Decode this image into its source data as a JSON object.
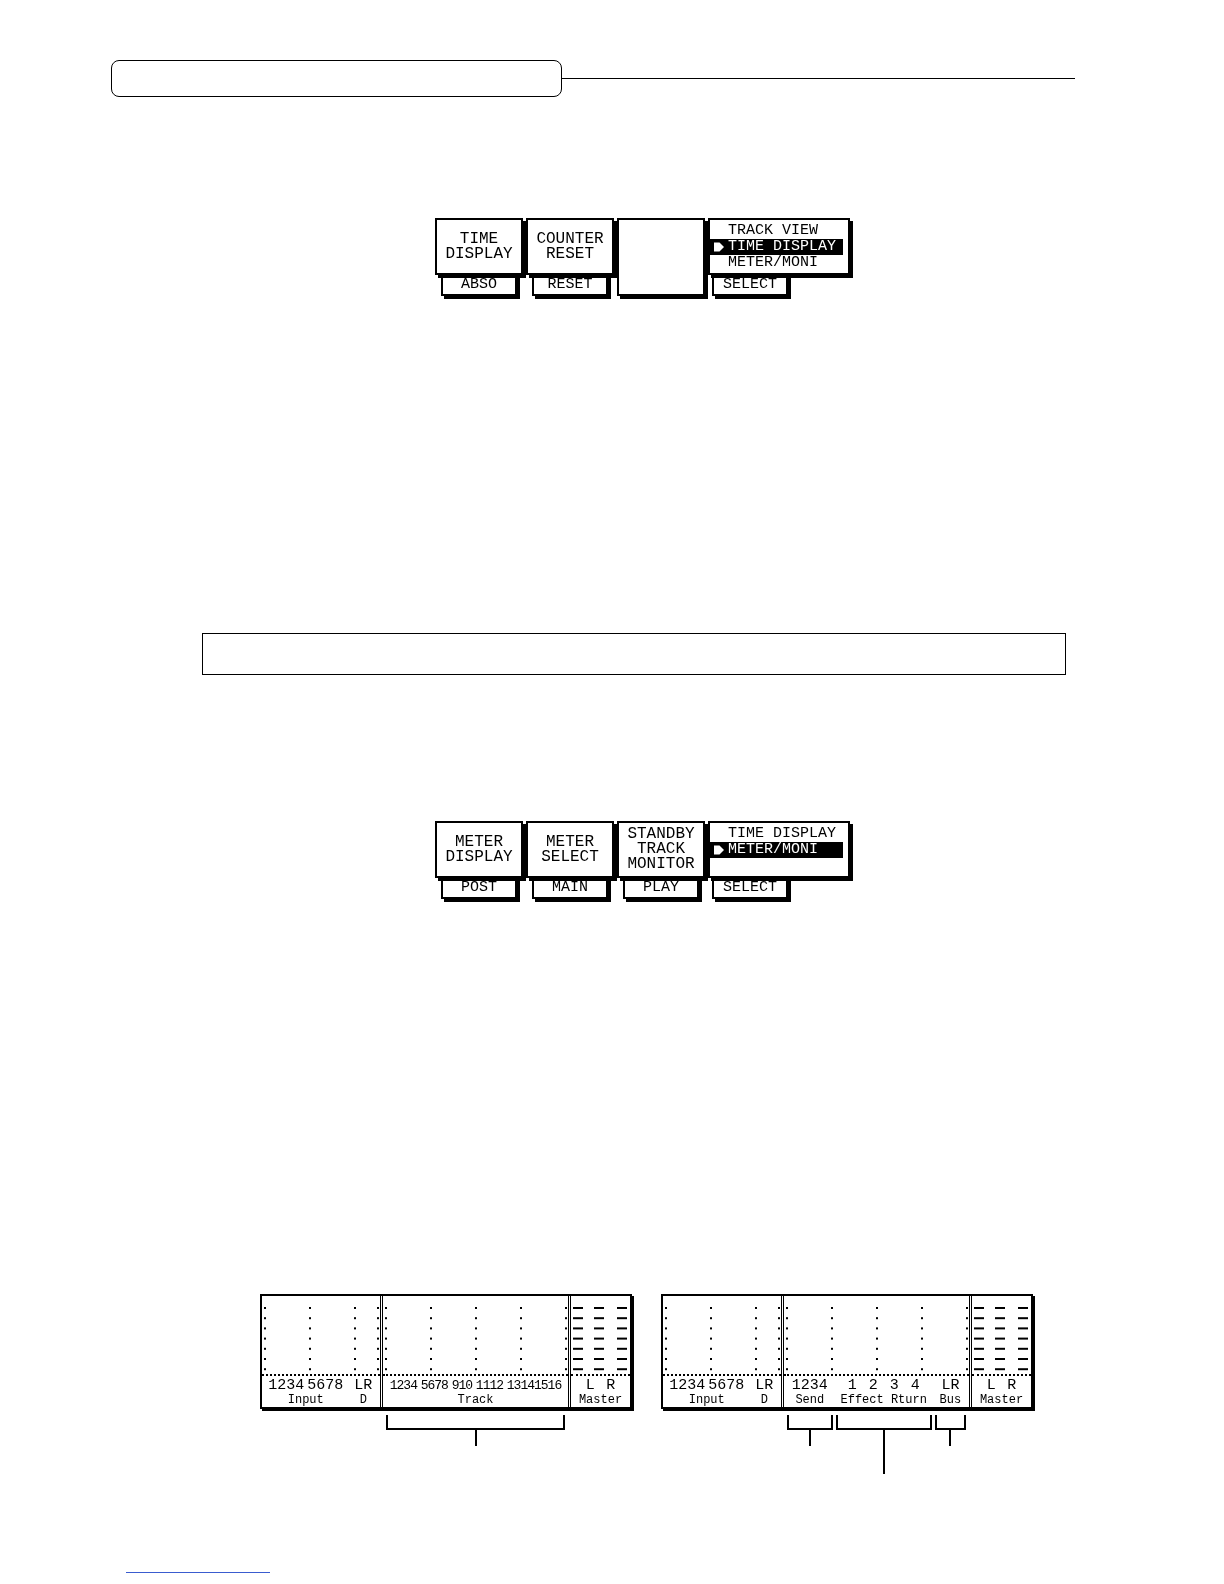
{
  "display_1": {
    "functions": [
      {
        "kind": "param",
        "title": "TIME DISPLAY",
        "value": "ABSO"
      },
      {
        "kind": "param",
        "title": "COUNTER RESET",
        "value": "RESET"
      },
      {
        "kind": "blank"
      },
      {
        "kind": "menu",
        "items": [
          {
            "label": "TRACK VIEW",
            "selected": false
          },
          {
            "label": "TIME DISPLAY",
            "selected": true
          },
          {
            "label": "METER/MONI",
            "selected": false
          }
        ],
        "value": "SELECT"
      }
    ]
  },
  "display_2": {
    "functions": [
      {
        "kind": "param",
        "title": "METER DISPLAY",
        "value": "POST"
      },
      {
        "kind": "param",
        "title": "METER SELECT",
        "value": "MAIN"
      },
      {
        "kind": "param",
        "title": "STANDBY TRACK MONITOR",
        "value": "PLAY"
      },
      {
        "kind": "menu",
        "items": [
          {
            "label": "TIME DISPLAY",
            "selected": false
          },
          {
            "label": "METER/MONI",
            "selected": true
          }
        ],
        "value": "SELECT"
      }
    ]
  },
  "meter_screens": [
    {
      "sections": [
        {
          "kind": "input",
          "groups": [
            {
              "channels": [
                "1234",
                "5678"
              ],
              "caption": "Input",
              "bracket": false
            },
            {
              "channels": [
                "LR"
              ],
              "caption": "D",
              "bracket": false
            }
          ]
        },
        {
          "kind": "main",
          "groups": [
            {
              "channels": [
                "1234",
                "5678",
                "910",
                "1112",
                "13141516"
              ],
              "caption": "Track",
              "bracket": true,
              "long_leader": false
            }
          ]
        },
        {
          "kind": "master",
          "groups": [
            {
              "channels": [
                "L",
                "R"
              ],
              "caption": "Master",
              "bracket": false
            }
          ]
        }
      ]
    },
    {
      "sections": [
        {
          "kind": "input",
          "groups": [
            {
              "channels": [
                "1234",
                "5678"
              ],
              "caption": "Input",
              "bracket": false
            },
            {
              "channels": [
                "LR"
              ],
              "caption": "D",
              "bracket": false
            }
          ]
        },
        {
          "kind": "main",
          "groups": [
            {
              "channels": [
                "1234"
              ],
              "caption": "Send",
              "bracket": true,
              "long_leader": false
            },
            {
              "channels": [
                "1",
                "2",
                "3",
                "4"
              ],
              "caption": "Effect Rturn",
              "bracket": true,
              "long_leader": true
            },
            {
              "channels": [
                "LR"
              ],
              "caption": "Bus",
              "bracket": true,
              "long_leader": false
            }
          ]
        },
        {
          "kind": "master",
          "groups": [
            {
              "channels": [
                "L",
                "R"
              ],
              "caption": "Master",
              "bracket": false
            }
          ]
        }
      ]
    }
  ]
}
